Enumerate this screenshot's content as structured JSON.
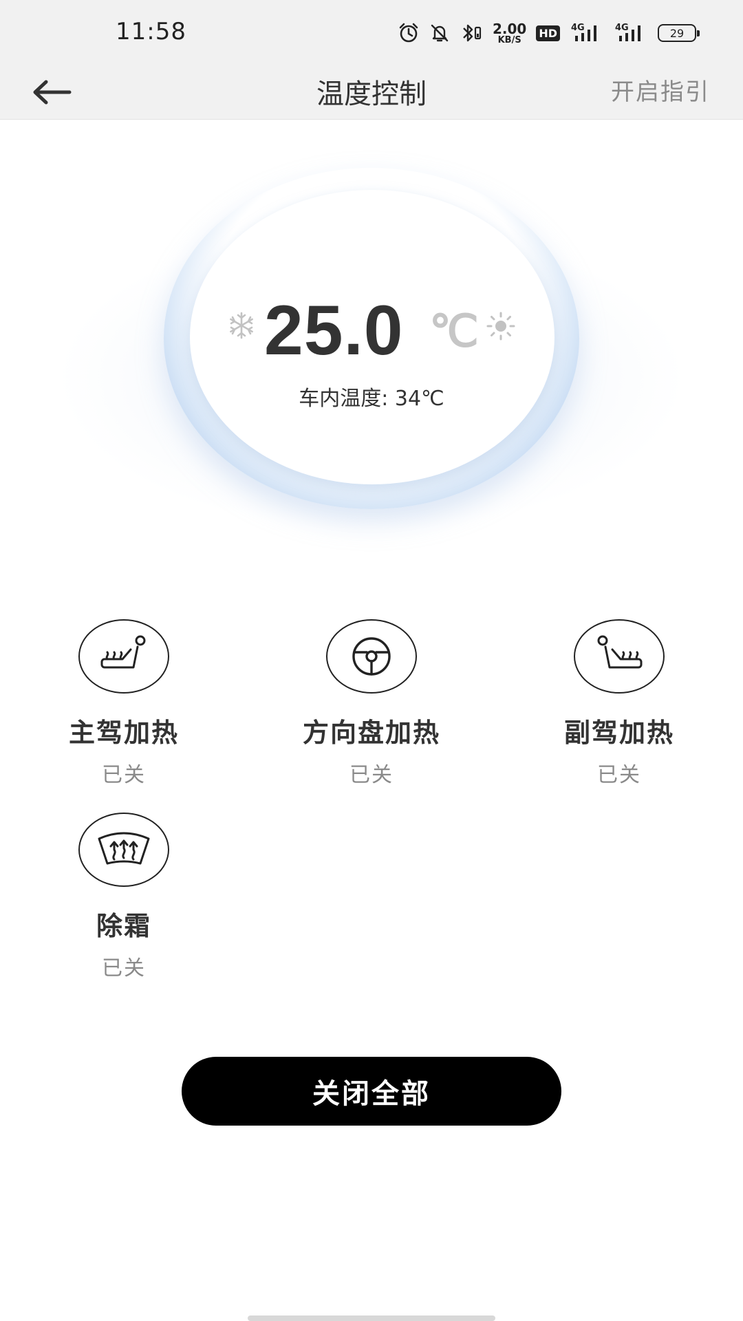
{
  "status_bar": {
    "time": "11:58",
    "net_speed_value": "2.00",
    "net_speed_unit": "KB/S",
    "hd_badge": "HD",
    "signal1_label": "4G",
    "signal2_label": "4G",
    "battery": "29",
    "icons": [
      "alarm-icon",
      "mute-icon",
      "bluetooth-icon",
      "hd-icon",
      "signal-icon",
      "signal-icon",
      "battery-icon"
    ]
  },
  "header": {
    "back_icon": "arrow-left-icon",
    "title": "温度控制",
    "guide_label": "开启指引"
  },
  "dial": {
    "temperature": "25.0",
    "unit": "℃",
    "cabin_temp": "车内温度: 34℃",
    "cool_icon": "snowflake-icon",
    "heat_icon": "sun-icon",
    "colors": {
      "ring": "#b4cdee",
      "value": "#333333",
      "unit": "#c6c6c6"
    }
  },
  "features": [
    {
      "label": "主驾加热",
      "status": "已关",
      "icon": "driver-seat-heat-icon"
    },
    {
      "label": "方向盘加热",
      "status": "已关",
      "icon": "steering-wheel-heat-icon"
    },
    {
      "label": "副驾加热",
      "status": "已关",
      "icon": "passenger-seat-heat-icon"
    },
    {
      "label": "除霜",
      "status": "已关",
      "icon": "defrost-icon"
    }
  ],
  "actions": {
    "close_all_label": "关闭全部"
  }
}
